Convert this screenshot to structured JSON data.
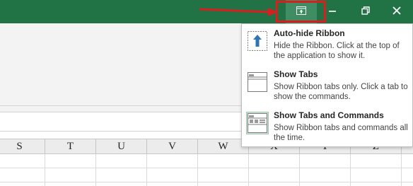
{
  "titlebar": {
    "buttons": [
      {
        "name": "ribbon-display-options-icon",
        "label": "Ribbon Display Options"
      },
      {
        "name": "minimize-icon",
        "glyph": "–"
      },
      {
        "name": "restore-icon",
        "glyph": "❐"
      },
      {
        "name": "close-icon",
        "glyph": "✕"
      }
    ]
  },
  "colors": {
    "title_bar": "#217346",
    "annotation": "#d81e1e",
    "selected_item": "#d6e8dc"
  },
  "grid": {
    "column_headers": [
      "S",
      "T",
      "U",
      "V",
      "W",
      "X",
      "Y",
      "Z"
    ]
  },
  "menu": {
    "items": [
      {
        "title": "Auto-hide Ribbon",
        "description": "Hide the Ribbon. Click at the top of the application to show it.",
        "icon": "auto-hide-ribbon-icon"
      },
      {
        "title": "Show Tabs",
        "description": "Show Ribbon tabs only. Click a tab to show the commands.",
        "icon": "show-tabs-icon"
      },
      {
        "title": "Show Tabs and Commands",
        "description": "Show Ribbon tabs and commands all the time.",
        "icon": "show-tabs-commands-icon",
        "selected": true
      }
    ]
  }
}
